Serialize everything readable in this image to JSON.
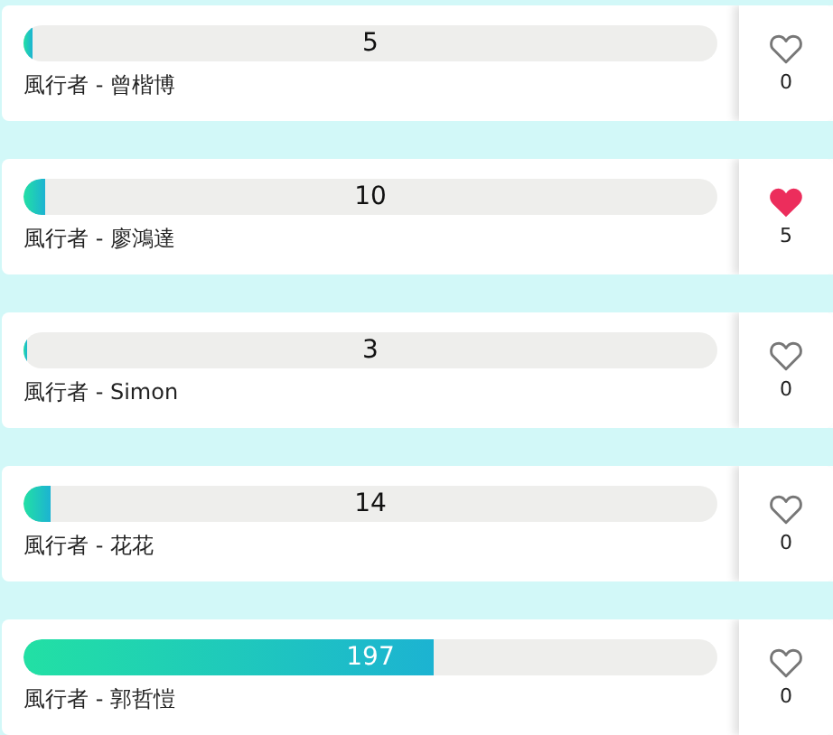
{
  "entries": [
    {
      "count": "5",
      "level": 0.012,
      "name": "風行者 - 曾楷博",
      "liked": false,
      "likes": "0"
    },
    {
      "count": "10",
      "level": 0.032,
      "name": "風行者 - 廖鴻達",
      "liked": true,
      "likes": "5"
    },
    {
      "count": "3",
      "level": 0.005,
      "name": "風行者 - Simon",
      "liked": false,
      "likes": "0"
    },
    {
      "count": "14",
      "level": 0.04,
      "name": "風行者 - 花花",
      "liked": false,
      "likes": "0"
    },
    {
      "count": "197",
      "level": 0.59,
      "name": "風行者 - 郭哲愷",
      "liked": false,
      "likes": "0"
    }
  ]
}
